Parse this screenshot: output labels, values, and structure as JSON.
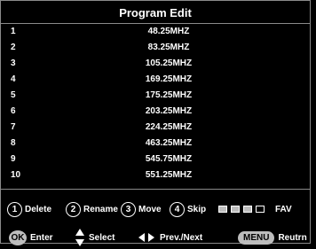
{
  "title": "Program Edit",
  "channels": [
    {
      "num": "1",
      "freq": "48.25MHZ"
    },
    {
      "num": "2",
      "freq": "83.25MHZ"
    },
    {
      "num": "3",
      "freq": "105.25MHZ"
    },
    {
      "num": "4",
      "freq": "169.25MHZ"
    },
    {
      "num": "5",
      "freq": "175.25MHZ"
    },
    {
      "num": "6",
      "freq": "203.25MHZ"
    },
    {
      "num": "7",
      "freq": "224.25MHZ"
    },
    {
      "num": "8",
      "freq": "463.25MHZ"
    },
    {
      "num": "9",
      "freq": "545.75MHZ"
    },
    {
      "num": "10",
      "freq": "551.25MHZ"
    }
  ],
  "legend": {
    "delete": {
      "key": "1",
      "label": "Delete"
    },
    "rename": {
      "key": "2",
      "label": "Rename"
    },
    "move": {
      "key": "3",
      "label": "Move"
    },
    "skip": {
      "key": "4",
      "label": "Skip"
    },
    "fav": "FAV"
  },
  "footer": {
    "ok_key": "OK",
    "enter": "Enter",
    "select": "Select",
    "prevnext": "Prev./Next",
    "menu_key": "MENU",
    "return": "Reutrn"
  },
  "colors": {
    "background": "#000000",
    "text": "#ffffff",
    "border": "#8a8a8a",
    "button": "#bdbdbd"
  }
}
